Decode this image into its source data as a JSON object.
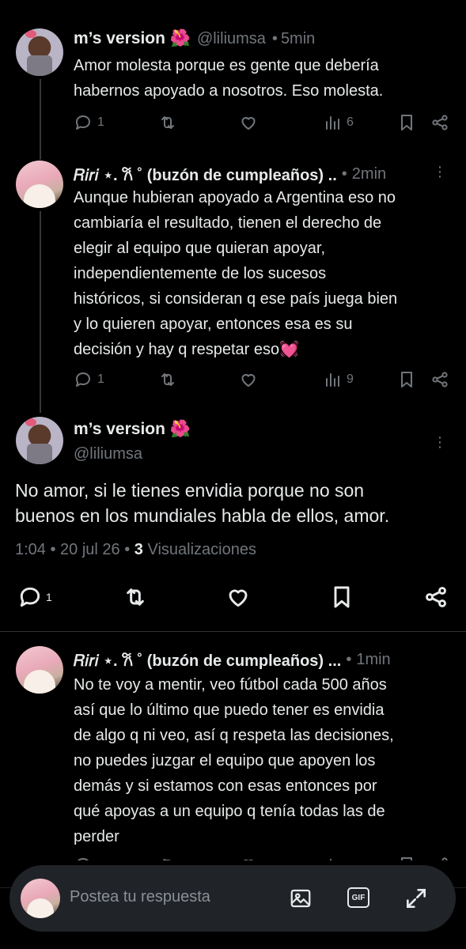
{
  "colors": {
    "background": "#000000",
    "text": "#e7e9ea",
    "muted": "#71767b",
    "reply_bar": "#202327",
    "heart_emoji": "#f91880"
  },
  "posts": [
    {
      "name": "m’s version 🌺",
      "handle": "@liliumsa",
      "time": "5min",
      "lines": [
        "Amor molesta porque es gente que debería",
        "habernos apoyado a nosotros. Eso molesta."
      ],
      "replies": "1",
      "views": "6"
    },
    {
      "name": "𝑅𝑖𝑟𝑖 ⋆. 𐙚 ˚ (buzón de cumpleaños) ..",
      "time": "2min",
      "lines": [
        "Aunque hubieran apoyado a Argentina eso no",
        "cambiaría el resultado, tienen el derecho de",
        "elegir al equipo que quieran apoyar,",
        "independientemente de los sucesos",
        "históricos, si consideran q ese país juega bien",
        "y lo quieren apoyar, entonces esa es su",
        "decisión y hay q respetar eso💓"
      ],
      "replies": "1",
      "views": "9"
    }
  ],
  "focus_post": {
    "name": "m’s version 🌺",
    "handle": "@liliumsa",
    "lines": [
      "No amor, si le tienes envidia porque no son",
      "buenos en los mundiales habla de ellos, amor."
    ],
    "timestamp": "1:04 • 20 jul 26 •",
    "views_count": "3",
    "views_label": "Visualizaciones",
    "replies": "1"
  },
  "reply_post": {
    "name": "𝑅𝑖𝑟𝑖 ⋆. 𐙚 ˚ (buzón de cumpleaños) ...",
    "time": "1min",
    "lines": [
      "No te voy a mentir, veo fútbol cada 500 años",
      "así que lo último que puedo tener es envidia",
      "de algo q ni veo, así q respeta las decisiones,",
      "no puedes juzgar el equipo que apoyen los",
      "demás y si estamos con esas entonces por",
      "qué apoyas a un equipo q tenía todas las de",
      "perder"
    ]
  },
  "reply_bar": {
    "placeholder": "Postea tu respuesta",
    "gif_label": "GIF"
  },
  "icons": [
    "reply-icon",
    "retweet-icon",
    "like-icon",
    "views-icon",
    "bookmark-icon",
    "share-icon",
    "more-icon",
    "image-icon",
    "gif-icon",
    "expand-icon"
  ]
}
